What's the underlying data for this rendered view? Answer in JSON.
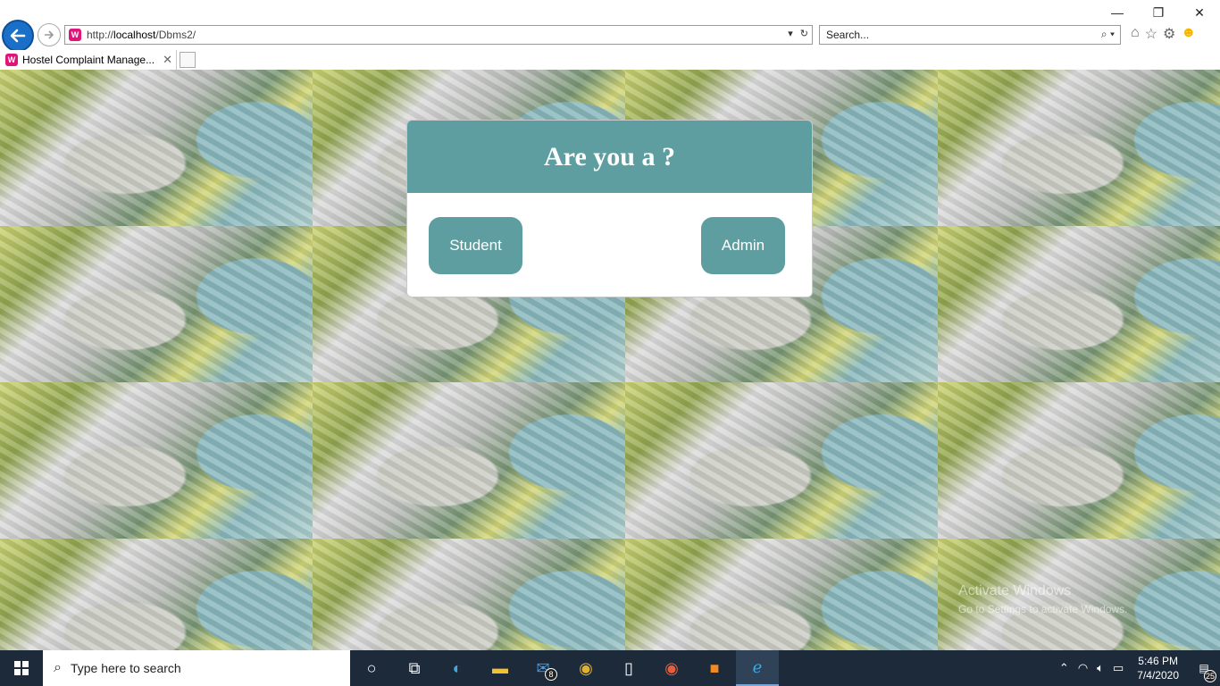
{
  "browser": {
    "url_prefix": "http://",
    "url_host": "localhost",
    "url_path": "/Dbms2/",
    "search_placeholder": "Search...",
    "tab_title": "Hostel Complaint Manage...",
    "favicon_text": "W"
  },
  "window_controls": {
    "minimize": "—",
    "maximize": "❐",
    "close": "✕"
  },
  "modal": {
    "title": "Are you a ?",
    "student_label": "Student",
    "admin_label": "Admin"
  },
  "watermark": {
    "line1": "Activate Windows",
    "line2": "Go to Settings to activate Windows."
  },
  "taskbar": {
    "search_placeholder": "Type here to search",
    "mail_badge": "8",
    "time": "5:46 PM",
    "date": "7/4/2020",
    "notification_count": "25"
  },
  "colors": {
    "accent": "#5f9ea0",
    "taskbar": "#1c2a3a",
    "back_button": "#1a6fc9"
  }
}
